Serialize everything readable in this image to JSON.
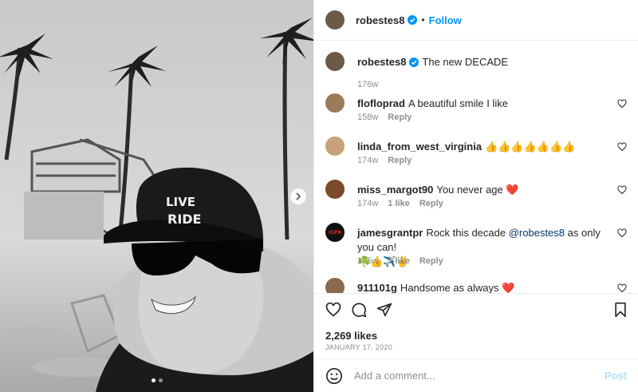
{
  "post": {
    "username": "robestes8",
    "follow_label": "Follow",
    "separator": "•",
    "caption": {
      "username": "robestes8",
      "text": "The new DECADE",
      "time": "176w"
    },
    "hat_text": "LIVE RIDE",
    "likes": "2,269 likes",
    "date": "January 17, 2020"
  },
  "comments": [
    {
      "username": "flofloprad",
      "text": "A beautiful smile I like",
      "time": "158w",
      "likes": "",
      "reply": "Reply",
      "avatar_color": "#9a7b5a"
    },
    {
      "username": "linda_from_west_virginia",
      "text": "👍👍👍👍👍👍👍",
      "time": "174w",
      "likes": "",
      "reply": "Reply",
      "avatar_color": "#c7a27a"
    },
    {
      "username": "miss_margot90",
      "text": "You never age",
      "emoji": "❤️",
      "time": "174w",
      "likes": "1 like",
      "reply": "Reply",
      "avatar_color": "#7a4a2a"
    },
    {
      "username": "jamesgrantpr",
      "text": "Rock this decade",
      "mention": "@robestes8",
      "text2": "as only you can!",
      "line2": "☘️👍✈️✌️",
      "time": "175w",
      "likes": "1 like",
      "reply": "Reply",
      "avatar_color": "#111111",
      "avatar_text": "IGPR"
    },
    {
      "username": "911101g",
      "text": "Handsome as always",
      "emoji": "❤️",
      "avatar_color": "#8a6a50"
    }
  ],
  "add_comment": {
    "placeholder": "Add a comment...",
    "post_label": "Post"
  },
  "icons": {
    "like": "heart-icon",
    "comment": "comment-icon",
    "share": "share-icon",
    "save": "bookmark-icon",
    "emoji": "emoji-icon",
    "next": "chevron-right-icon",
    "verified": "verified-badge-icon"
  },
  "colors": {
    "accent": "#0095f6",
    "verified": "#0095f6",
    "heart_red": "#ed4956",
    "muted": "#8e8e8e"
  }
}
